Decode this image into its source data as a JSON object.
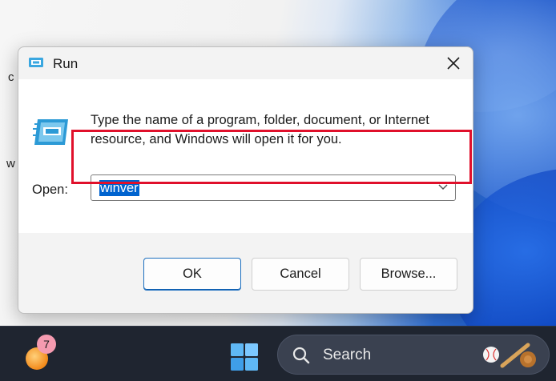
{
  "dialog": {
    "title": "Run",
    "description": "Type the name of a program, folder, document, or Internet resource, and Windows will open it for you.",
    "open_label": "Open:",
    "input_value": "winver",
    "buttons": {
      "ok": "OK",
      "cancel": "Cancel",
      "browse": "Browse..."
    }
  },
  "taskbar": {
    "search_placeholder": "Search",
    "weather_badge": "7"
  },
  "colors": {
    "highlight": "#e0102b",
    "selection": "#0063cf",
    "taskbar": "#1f2530"
  },
  "icons": [
    "run-app-icon",
    "run-program-icon",
    "close-icon",
    "chevron-down-icon",
    "weather-icon",
    "windows-logo-icon",
    "search-icon",
    "baseball-icon"
  ]
}
